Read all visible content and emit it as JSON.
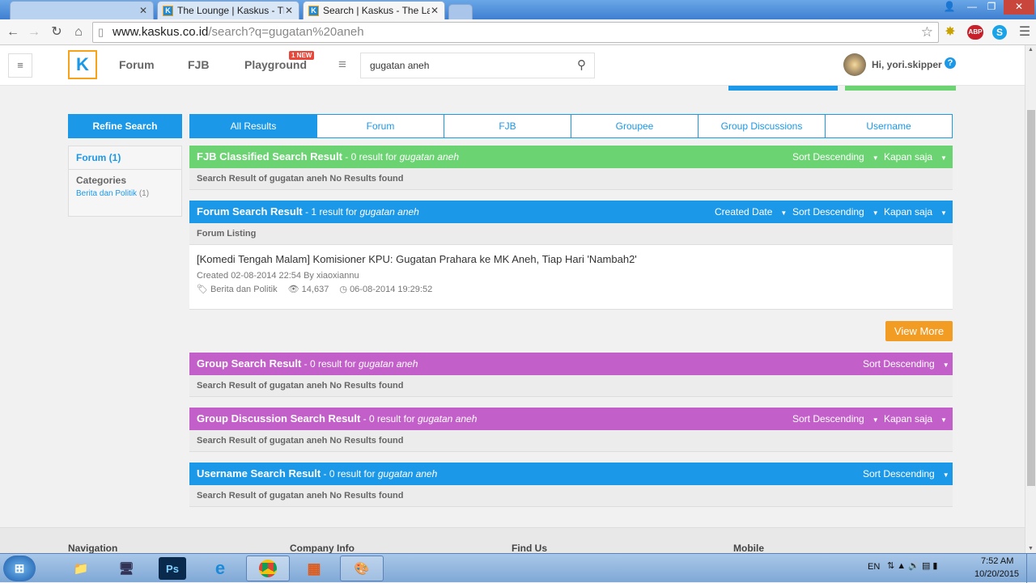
{
  "browser": {
    "tabs": [
      {
        "label": ""
      },
      {
        "label": "The Lounge | Kaskus - The"
      },
      {
        "label": "Search | Kaskus - The Larg"
      }
    ],
    "url_host": "www.kaskus.co.id",
    "url_path": "/search?q=gugatan%20aneh"
  },
  "header": {
    "nav": [
      "Forum",
      "FJB",
      "Playground"
    ],
    "new_badge": "1 NEW",
    "search_value": "gugatan aneh",
    "user": "Hi, yori.skipper",
    "help": "?"
  },
  "sidebar": {
    "refine": "Refine Search",
    "forum_count": "Forum (1)",
    "categories_title": "Categories",
    "category": "Berita dan Politik",
    "category_count": "(1)"
  },
  "tabs": [
    "All Results",
    "Forum",
    "FJB",
    "Groupee",
    "Group Discussions",
    "Username"
  ],
  "sections": {
    "fjb": {
      "title": "FJB Classified Search Result",
      "count": " - 0 result for ",
      "query": "gugatan aneh",
      "sort": "Sort Descending",
      "time": "Kapan saja",
      "empty": "Search Result of gugatan aneh No Results found"
    },
    "forum": {
      "title": "Forum Search Result",
      "count": " - 1 result for ",
      "query": "gugatan aneh",
      "date": "Created Date",
      "sort": "Sort Descending",
      "time": "Kapan saja",
      "listing": "Forum Listing"
    },
    "group": {
      "title": "Group Search Result",
      "count": " - 0 result for ",
      "query": "gugatan aneh",
      "sort": "Sort Descending",
      "empty": "Search Result of gugatan aneh No Results found"
    },
    "groupdisc": {
      "title": "Group Discussion Search Result",
      "count": " - 0 result for ",
      "query": "gugatan aneh",
      "sort": "Sort Descending",
      "time": "Kapan saja",
      "empty": "Search Result of gugatan aneh No Results found"
    },
    "username": {
      "title": "Username Search Result",
      "count": " - 0 result for ",
      "query": "gugatan aneh",
      "sort": "Sort Descending",
      "empty": "Search Result of gugatan aneh No Results found"
    }
  },
  "result": {
    "title": "[Komedi Tengah Malam] Komisioner KPU: Gugatan Prahara ke MK Aneh, Tiap Hari 'Nambah2'",
    "created": "Created 02-08-2014 22:54 By xiaoxiannu",
    "category": "Berita dan Politik",
    "views": "14,637",
    "last": "06-08-2014 19:29:52"
  },
  "view_more": "View More",
  "footer": [
    "Navigation",
    "Company Info",
    "Find Us",
    "Mobile"
  ],
  "taskbar": {
    "lang": "EN",
    "time": "7:52 AM",
    "date": "10/20/2015"
  },
  "colors": {
    "blue": "#1c98e8",
    "green": "#6bd372",
    "purple": "#c35fc9",
    "orange": "#f39c23"
  }
}
